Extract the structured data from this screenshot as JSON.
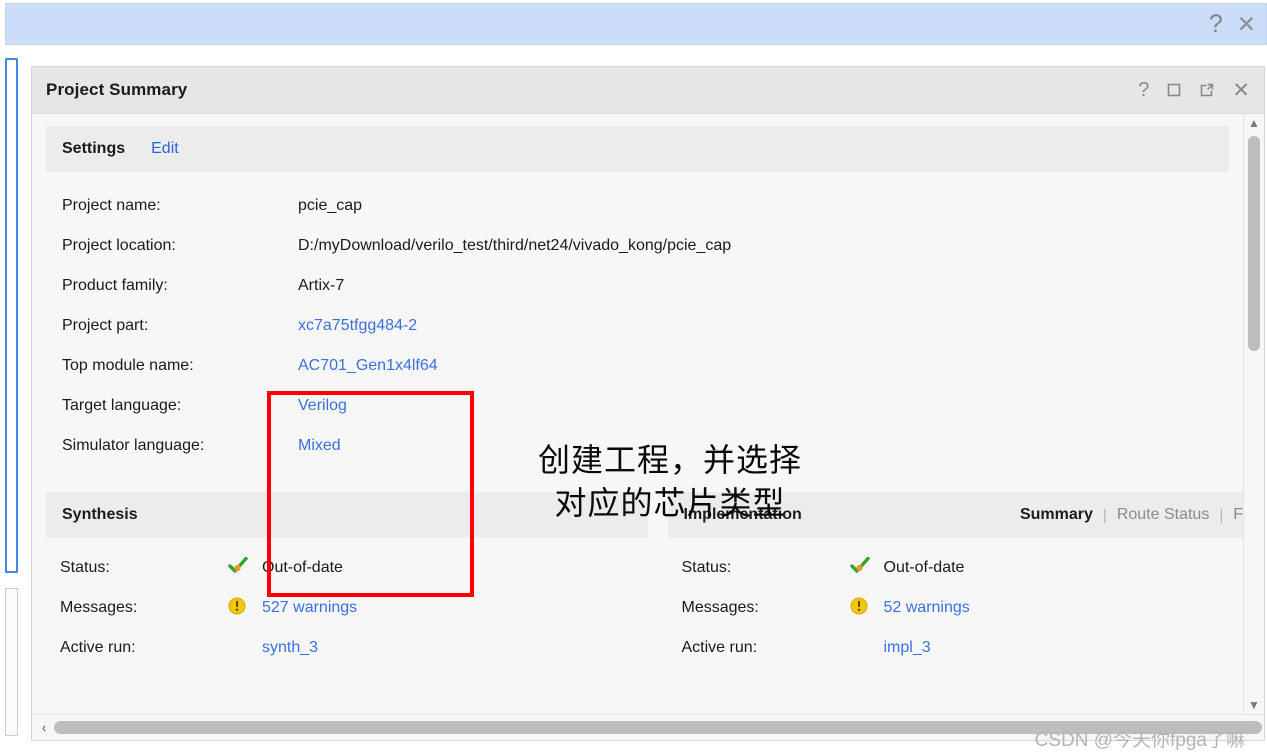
{
  "window": {
    "topbar": {
      "help_icon": "question-mark-icon",
      "close_icon": "close-icon",
      "background_color": "#cbdcf8"
    }
  },
  "panel": {
    "title": "Project Summary",
    "icons": [
      "help-icon",
      "maximize-icon",
      "float-icon",
      "close-icon"
    ]
  },
  "settings": {
    "header": {
      "title": "Settings",
      "edit_link": "Edit"
    },
    "rows": [
      {
        "key": "Project name:",
        "value": "pcie_cap",
        "link": false
      },
      {
        "key": "Project location:",
        "value": "D:/myDownload/verilo_test/third/net24/vivado_kong/pcie_cap",
        "link": false
      },
      {
        "key": "Product family:",
        "value": "Artix-7",
        "link": false
      },
      {
        "key": "Project part:",
        "value": "xc7a75tfgg484-2",
        "link": true
      },
      {
        "key": "Top module name:",
        "value": "AC701_Gen1x4lf64",
        "link": true
      },
      {
        "key": "Target language:",
        "value": "Verilog",
        "link": true
      },
      {
        "key": "Simulator language:",
        "value": "Mixed",
        "link": true
      }
    ]
  },
  "annotation": {
    "text": "创建工程，并选择\n对应的芯片类型",
    "box_color": "#fe0000"
  },
  "synthesis": {
    "header": {
      "title": "Synthesis"
    },
    "rows": [
      {
        "key": "Status:",
        "value": "Out-of-date",
        "icon": "check-orange-icon",
        "link": false
      },
      {
        "key": "Messages:",
        "value": "527 warnings",
        "icon": "warning-icon",
        "link": true
      },
      {
        "key": "Active run:",
        "value": "synth_3",
        "icon": "",
        "link": true
      }
    ]
  },
  "implementation": {
    "header": {
      "title": "Implementation",
      "tabs": [
        {
          "label": "Summary",
          "active": true
        },
        {
          "label": "Route Status",
          "active": false
        },
        {
          "label": "Fail",
          "active": false
        }
      ]
    },
    "rows": [
      {
        "key": "Status:",
        "value": "Out-of-date",
        "icon": "check-orange-icon",
        "link": false
      },
      {
        "key": "Messages:",
        "value": "52 warnings",
        "icon": "warning-icon",
        "link": true
      },
      {
        "key": "Active run:",
        "value": "impl_3",
        "icon": "",
        "link": true
      }
    ]
  },
  "scrollbars": {
    "vertical": {
      "up_arrow": "chevron-up-icon",
      "down_arrow": "chevron-down-icon"
    },
    "horizontal": {
      "left_arrow": "chevron-left-icon"
    }
  },
  "watermark": "CSDN @今天你fpga了嘛"
}
